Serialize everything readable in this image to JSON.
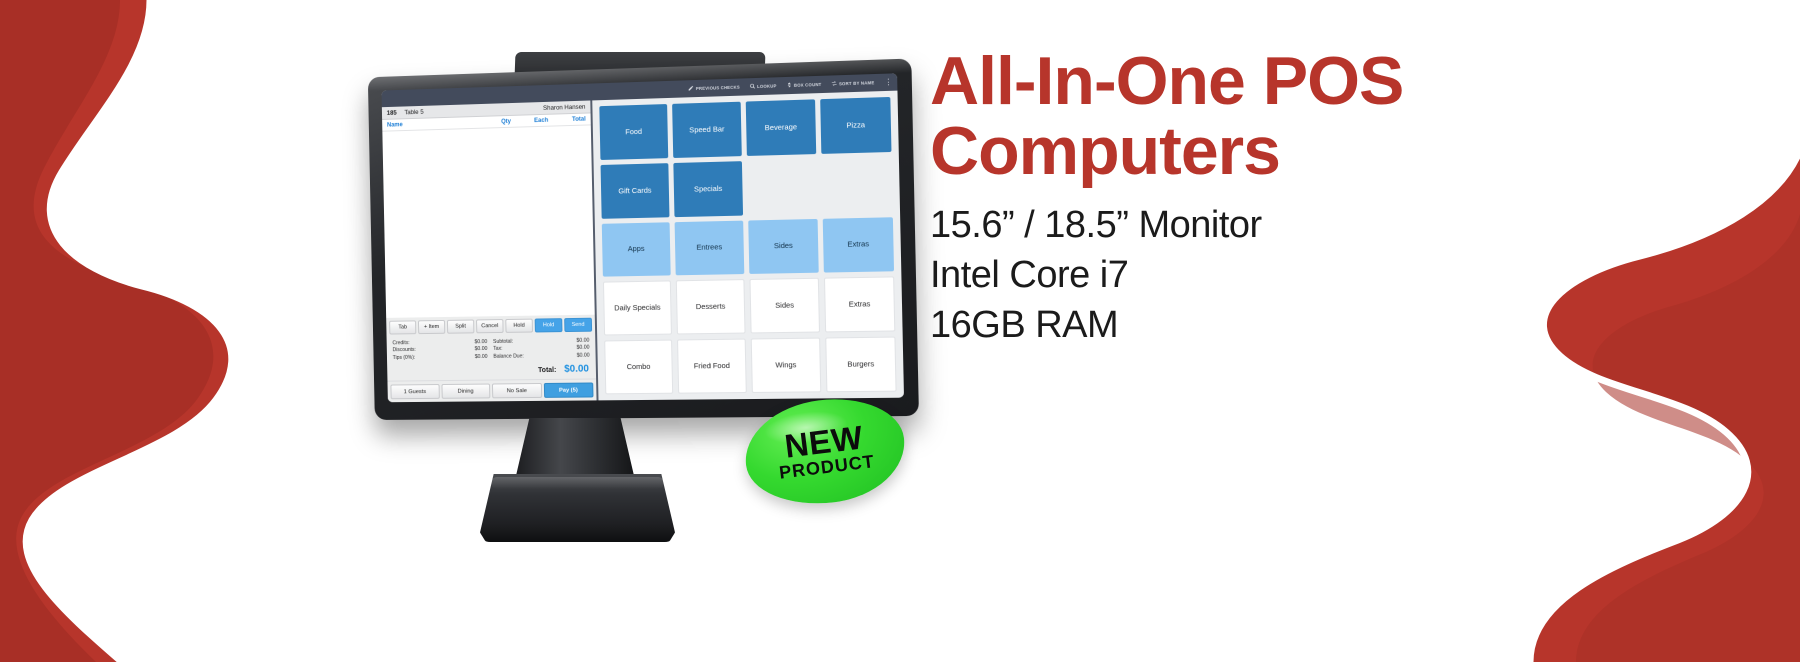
{
  "theme": {
    "brand_red": "#b7352b",
    "pos_accent_blue": "#1c8fe0",
    "badge_green": "#35d92f"
  },
  "promo": {
    "headline_line1": "All-In-One POS",
    "headline_line2": "Computers",
    "specs": [
      "15.6” / 18.5” Monitor",
      "Intel Core i7",
      "16GB RAM"
    ]
  },
  "badge": {
    "line1": "NEW",
    "line2": "PRODUCT"
  },
  "pos": {
    "toolbar": [
      {
        "icon": "pencil-icon",
        "label": "PREVIOUS CHECKS"
      },
      {
        "icon": "search-icon",
        "label": "LOOKUP"
      },
      {
        "icon": "dollar-icon",
        "label": "BOX COUNT"
      },
      {
        "icon": "switch-icon",
        "label": "SORT BY NAME"
      },
      {
        "icon": "kebab-menu-icon",
        "label": ""
      }
    ],
    "order": {
      "check_number": "185",
      "table": "Table 5",
      "server": "Sharon Hansen",
      "columns": {
        "name": "Name",
        "qty": "Qty",
        "each": "Each",
        "total": "Total"
      },
      "items": [],
      "actions": [
        {
          "label": "Tab",
          "accent": false
        },
        {
          "label": "+ Item",
          "accent": false
        },
        {
          "label": "Split",
          "accent": false
        },
        {
          "label": "Cancel",
          "accent": false
        },
        {
          "label": "Hold",
          "accent": false
        },
        {
          "label": "Hold",
          "accent": true
        },
        {
          "label": "Send",
          "accent": true
        }
      ],
      "totals_left": [
        {
          "label": "Credits:",
          "value": "$0.00"
        },
        {
          "label": "Discounts:",
          "value": "$0.00"
        },
        {
          "label": "Tips (0%):",
          "value": "$0.00"
        }
      ],
      "totals_right": [
        {
          "label": "Subtotal:",
          "value": "$0.00"
        },
        {
          "label": "Tax:",
          "value": "$0.00"
        },
        {
          "label": "Balance Due:",
          "value": "$0.00"
        }
      ],
      "total_label": "Total:",
      "total_value": "$0.00",
      "bottom_buttons": [
        {
          "label": "1 Guests",
          "pay": false
        },
        {
          "label": "Dining",
          "pay": false
        },
        {
          "label": "No Sale",
          "pay": false
        },
        {
          "label": "Pay (5)",
          "pay": true
        }
      ]
    },
    "categories": [
      {
        "label": "Food",
        "style": "dark"
      },
      {
        "label": "Speed Bar",
        "style": "dark"
      },
      {
        "label": "Beverage",
        "style": "dark"
      },
      {
        "label": "Pizza",
        "style": "dark"
      },
      {
        "label": "Gift Cards",
        "style": "dark"
      },
      {
        "label": "Specials",
        "style": "dark"
      },
      {
        "label": "",
        "style": "empty"
      },
      {
        "label": "",
        "style": "empty"
      },
      {
        "label": "Apps",
        "style": "light"
      },
      {
        "label": "Entrees",
        "style": "light"
      },
      {
        "label": "Sides",
        "style": "light"
      },
      {
        "label": "Extras",
        "style": "light"
      },
      {
        "label": "Daily Specials",
        "style": "white"
      },
      {
        "label": "Desserts",
        "style": "white"
      },
      {
        "label": "Sides",
        "style": "white"
      },
      {
        "label": "Extras",
        "style": "white"
      },
      {
        "label": "Combo",
        "style": "white"
      },
      {
        "label": "Fried Food",
        "style": "white"
      },
      {
        "label": "Wings",
        "style": "white"
      },
      {
        "label": "Burgers",
        "style": "white"
      }
    ]
  }
}
